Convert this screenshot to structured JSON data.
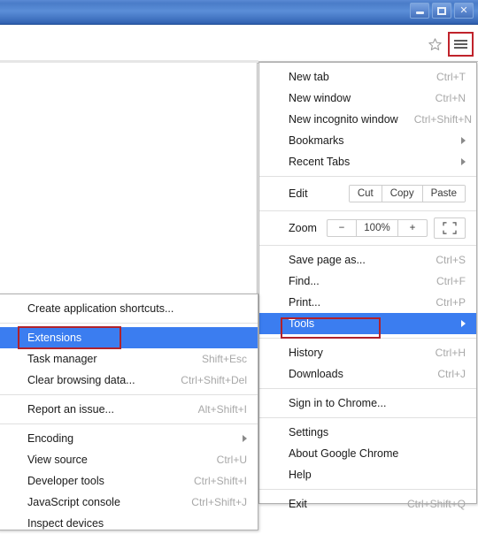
{
  "window": {
    "minimize_label": "Minimize",
    "maximize_label": "Restore",
    "close_label": "✕"
  },
  "toolbar": {
    "bookmark_star_icon": "star-icon",
    "menu_icon": "hamburger-menu-icon",
    "highlight_color": "#c0232b"
  },
  "main_menu": {
    "items": [
      {
        "label": "New tab",
        "accel": "Ctrl+T"
      },
      {
        "label": "New window",
        "accel": "Ctrl+N"
      },
      {
        "label": "New incognito window",
        "accel": "Ctrl+Shift+N"
      },
      {
        "label": "Bookmarks",
        "accel": "",
        "arrow": true
      },
      {
        "label": "Recent Tabs",
        "accel": "",
        "arrow": true
      }
    ],
    "edit_row": {
      "label": "Edit",
      "buttons": [
        "Cut",
        "Copy",
        "Paste"
      ]
    },
    "zoom_row": {
      "label": "Zoom",
      "minus": "−",
      "value": "100%",
      "plus": "+",
      "fullscreen_icon": "fullscreen-icon"
    },
    "items2": [
      {
        "label": "Save page as...",
        "accel": "Ctrl+S"
      },
      {
        "label": "Find...",
        "accel": "Ctrl+F"
      },
      {
        "label": "Print...",
        "accel": "Ctrl+P"
      }
    ],
    "tools_item": {
      "label": "Tools",
      "accel": "",
      "arrow": true,
      "selected": true
    },
    "items3": [
      {
        "label": "History",
        "accel": "Ctrl+H"
      },
      {
        "label": "Downloads",
        "accel": "Ctrl+J"
      }
    ],
    "items4": [
      {
        "label": "Sign in to Chrome...",
        "accel": ""
      }
    ],
    "items5": [
      {
        "label": "Settings",
        "accel": ""
      },
      {
        "label": "About Google Chrome",
        "accel": ""
      },
      {
        "label": "Help",
        "accel": ""
      }
    ],
    "items6": [
      {
        "label": "Exit",
        "accel": "Ctrl+Shift+Q"
      }
    ]
  },
  "tools_submenu": {
    "items1": [
      {
        "label": "Create application shortcuts...",
        "accel": ""
      }
    ],
    "extensions_item": {
      "label": "Extensions",
      "accel": "",
      "selected": true
    },
    "items2": [
      {
        "label": "Task manager",
        "accel": "Shift+Esc"
      },
      {
        "label": "Clear browsing data...",
        "accel": "Ctrl+Shift+Del"
      }
    ],
    "items3": [
      {
        "label": "Report an issue...",
        "accel": "Alt+Shift+I"
      }
    ],
    "items4": [
      {
        "label": "Encoding",
        "accel": "",
        "arrow": true
      },
      {
        "label": "View source",
        "accel": "Ctrl+U"
      },
      {
        "label": "Developer tools",
        "accel": "Ctrl+Shift+I"
      },
      {
        "label": "JavaScript console",
        "accel": "Ctrl+Shift+J"
      },
      {
        "label": "Inspect devices",
        "accel": ""
      }
    ]
  },
  "annotations": {
    "tools_box_color": "#b0222c",
    "extensions_box_color": "#b0222c",
    "menu_button_box_color": "#c0232b"
  }
}
